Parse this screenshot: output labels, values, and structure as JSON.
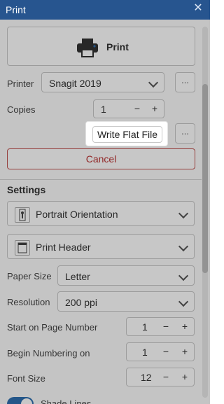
{
  "window": {
    "title": "Print",
    "close_glyph": "✕"
  },
  "print_button": {
    "label": "Print",
    "icon": "printer-icon"
  },
  "printer": {
    "label": "Printer",
    "value": "Snagit 2019",
    "ellipsis": "..."
  },
  "copies": {
    "label": "Copies",
    "value": "1",
    "minus": "−",
    "plus": "+"
  },
  "write_flat_file": {
    "label": "Write Flat File",
    "ellipsis": "..."
  },
  "cancel": {
    "label": "Cancel"
  },
  "settings": {
    "heading": "Settings",
    "orientation": {
      "value": "Portrait Orientation",
      "icon": "portrait-orientation-icon"
    },
    "header": {
      "value": "Print Header",
      "icon": "header-icon"
    },
    "paper_size": {
      "label": "Paper Size",
      "value": "Letter"
    },
    "resolution": {
      "label": "Resolution",
      "value": "200 ppi"
    },
    "start_page": {
      "label": "Start on Page Number",
      "value": "1",
      "minus": "−",
      "plus": "+"
    },
    "begin_numbering": {
      "label": "Begin Numbering on",
      "value": "1",
      "minus": "−",
      "plus": "+"
    },
    "font_size": {
      "label": "Font Size",
      "value": "12",
      "minus": "−",
      "plus": "+"
    },
    "shade_lines": {
      "label": "Shade Lines",
      "enabled": true
    }
  },
  "colors": {
    "titlebar": "#27558f",
    "cancel": "#c0504d",
    "toggle": "#2f6fb0"
  }
}
